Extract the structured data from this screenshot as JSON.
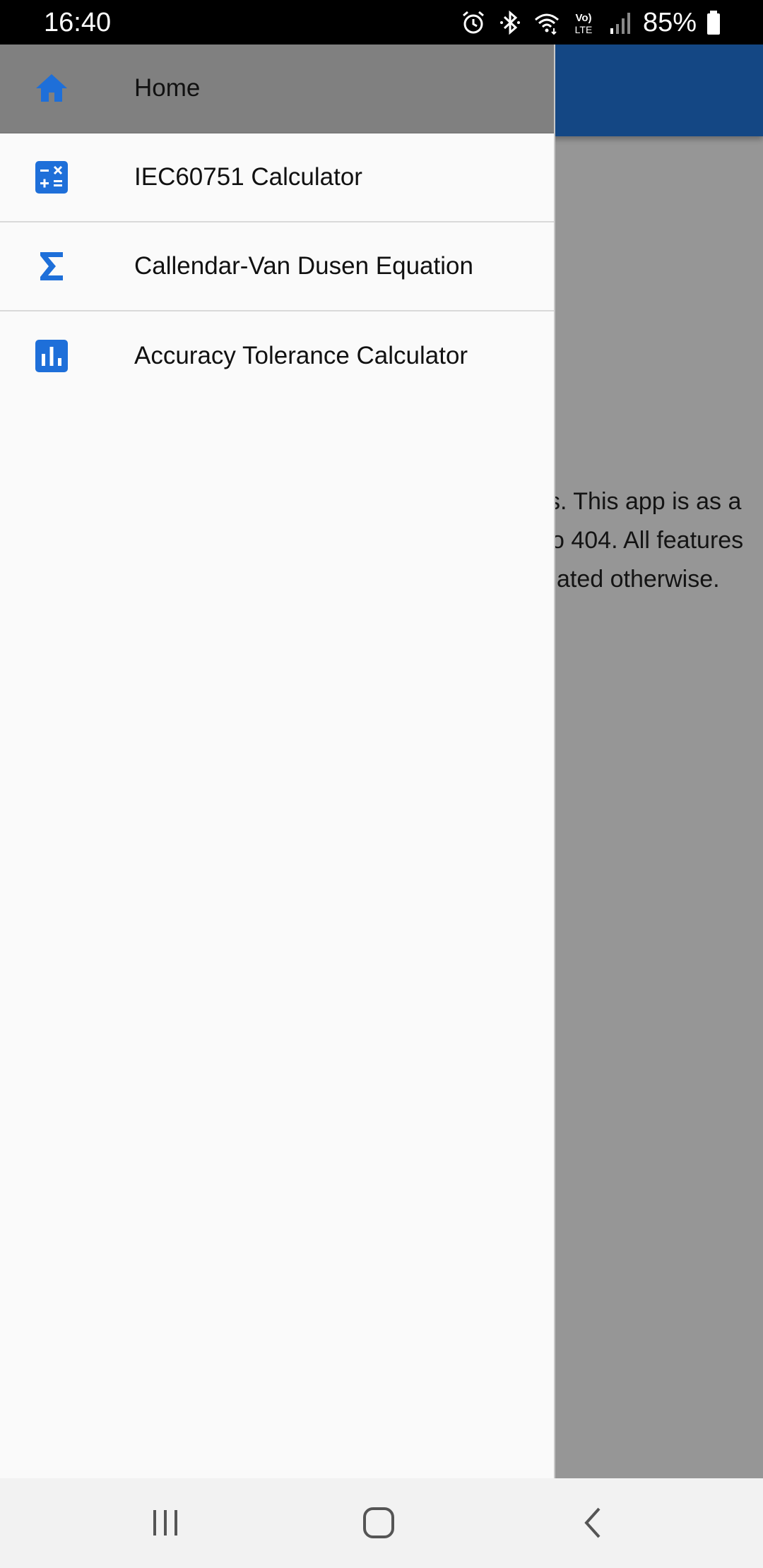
{
  "status_bar": {
    "time": "16:40",
    "battery": "85%",
    "icons": [
      "alarm-icon",
      "bluetooth-icon",
      "wifi-icon",
      "volte-icon",
      "signal-icon",
      "battery-icon"
    ]
  },
  "background_app": {
    "text_lines": [
      "s. This app is as a",
      "o 404. All features",
      "ated otherwise."
    ]
  },
  "drawer": {
    "items": [
      {
        "label": "Home",
        "icon": "home-icon",
        "selected": true
      },
      {
        "label": "IEC60751 Calculator",
        "icon": "calculator-icon",
        "selected": false
      },
      {
        "label": "Callendar-Van Dusen Equation",
        "icon": "sigma-icon",
        "selected": false
      },
      {
        "label": "Accuracy Tolerance Calculator",
        "icon": "bar-chart-icon",
        "selected": false
      }
    ]
  },
  "nav_bar": {
    "buttons": [
      "recents-button",
      "home-button",
      "back-button"
    ]
  },
  "colors": {
    "accent": "#1e6fd9",
    "app_bar": "#2277dd",
    "selected_item": "#808080"
  }
}
